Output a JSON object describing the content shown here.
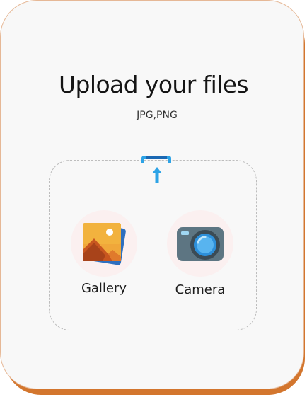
{
  "dialog": {
    "title": "Upload your files",
    "formats": "JPG,PNG"
  },
  "dropzone": {
    "icon": "upload-arrow-icon",
    "accent_color": "#2da3e6"
  },
  "options": [
    {
      "label": "Gallery",
      "icon": "gallery-photos-icon"
    },
    {
      "label": "Camera",
      "icon": "camera-icon"
    }
  ],
  "colors": {
    "card_background": "#f8f8f8",
    "card_shadow": "#d3762e",
    "card_border": "#e6b896",
    "bubble": "#fbf0f0"
  }
}
